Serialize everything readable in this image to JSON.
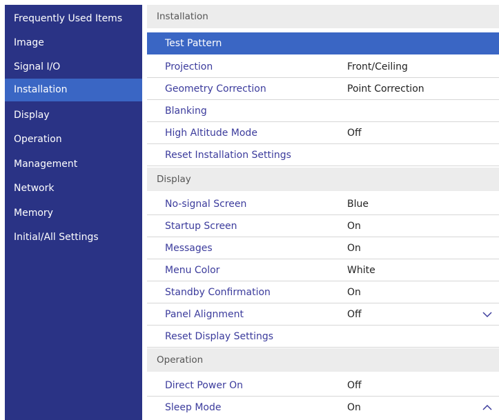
{
  "sidebar": {
    "items": [
      {
        "label": "Frequently Used Items"
      },
      {
        "label": "Image"
      },
      {
        "label": "Signal I/O"
      },
      {
        "label": "Installation"
      },
      {
        "label": "Display"
      },
      {
        "label": "Operation"
      },
      {
        "label": "Management"
      },
      {
        "label": "Network"
      },
      {
        "label": "Memory"
      },
      {
        "label": "Initial/All Settings"
      }
    ],
    "selected": "Installation"
  },
  "sections": [
    {
      "title": "Installation",
      "rows": [
        {
          "label": "Test Pattern",
          "value": ""
        },
        {
          "label": "Projection",
          "value": "Front/Ceiling"
        },
        {
          "label": "Geometry Correction",
          "value": "Point Correction"
        },
        {
          "label": "Blanking",
          "value": ""
        },
        {
          "label": "High Altitude Mode",
          "value": "Off"
        },
        {
          "label": "Reset Installation Settings",
          "value": ""
        }
      ]
    },
    {
      "title": "Display",
      "rows": [
        {
          "label": "No-signal Screen",
          "value": "Blue"
        },
        {
          "label": "Startup Screen",
          "value": "On"
        },
        {
          "label": "Messages",
          "value": "On"
        },
        {
          "label": "Menu Color",
          "value": "White"
        },
        {
          "label": "Standby Confirmation",
          "value": "On"
        },
        {
          "label": "Panel Alignment",
          "value": "Off"
        },
        {
          "label": "Reset Display Settings",
          "value": ""
        }
      ]
    },
    {
      "title": "Operation",
      "rows": [
        {
          "label": "Direct Power On",
          "value": "Off"
        },
        {
          "label": "Sleep Mode",
          "value": "On"
        }
      ]
    }
  ],
  "selected_row": "Test Pattern",
  "icons": {
    "scroll_down": "chevron-down-icon",
    "scroll_up": "chevron-up-icon"
  },
  "colors": {
    "sidebar_bg": "#2a3385",
    "highlight": "#3a66c4",
    "label_text": "#3b3b9c",
    "section_header_bg": "#ececec"
  }
}
